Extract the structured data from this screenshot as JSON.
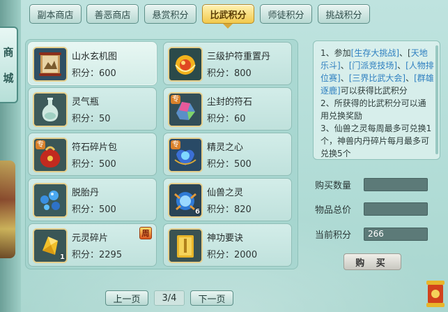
{
  "side_tab": {
    "chars": [
      "商",
      "城"
    ]
  },
  "tabs": [
    "副本商店",
    "善恶商店",
    "悬赏积分",
    "比武积分",
    "师徒积分",
    "挑战积分"
  ],
  "active_tab_index": 3,
  "price_label": "积分：",
  "items": [
    {
      "name": "山水玄机图",
      "price": "600",
      "icon": "scroll-map-icon"
    },
    {
      "name": "三级护符重置丹",
      "price": "800",
      "icon": "golden-pill-icon"
    },
    {
      "name": "灵气瓶",
      "price": "50",
      "icon": "vase-icon"
    },
    {
      "name": "尘封的符石",
      "price": "60",
      "icon": "gem-stone-icon",
      "tag": "专"
    },
    {
      "name": "符石碎片包",
      "price": "500",
      "icon": "red-pouch-icon",
      "tag": "专"
    },
    {
      "name": "精灵之心",
      "price": "500",
      "icon": "spirit-heart-icon",
      "tag": "专"
    },
    {
      "name": "脱胎丹",
      "price": "500",
      "icon": "blue-pills-icon"
    },
    {
      "name": "仙兽之灵",
      "price": "820",
      "icon": "beast-orb-icon",
      "qty": "6"
    },
    {
      "name": "元灵碎片",
      "price": "2295",
      "icon": "crystal-shard-icon",
      "qty": "1",
      "badge": "周"
    },
    {
      "name": "神功要诀",
      "price": "2000",
      "icon": "golden-book-icon"
    }
  ],
  "rules": {
    "p1_a": "1、参加",
    "p1_b": "[生存大挑战]",
    "p1_c": "、[",
    "p1_d": "天地乐斗]",
    "p1_e": "、",
    "p1_f": "[门派竞技场]",
    "p1_g": "、",
    "p1_h": "[人物排位赛]",
    "p1_i": "、",
    "p1_j": "[三界比武大会]",
    "p1_k": "、",
    "p1_l": "[群雄逐鹿]",
    "p1_m": "可以获得比武积分",
    "p2": "2、所获得的比武积分可以通用兑换奖励",
    "p3": "3、仙兽之灵每周最多可兑换1个，神兽内丹碎片每月最多可兑换5个"
  },
  "form": {
    "qty_label": "购买数量",
    "qty_value": "",
    "total_label": "物品总价",
    "total_value": "",
    "points_label": "当前积分",
    "points_value": "266"
  },
  "buy_label": "购 买",
  "pager": {
    "prev": "上一页",
    "indicator": "3/4",
    "next": "下一页"
  }
}
